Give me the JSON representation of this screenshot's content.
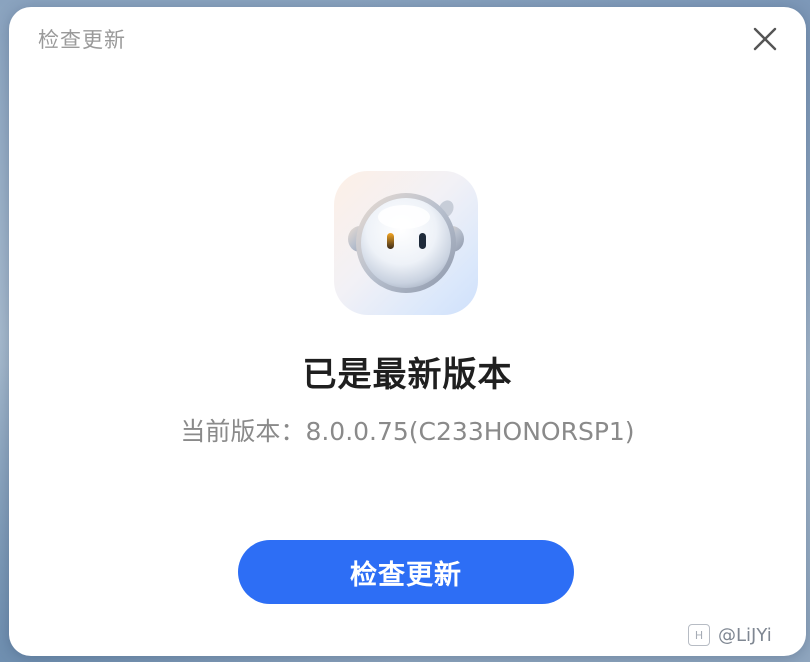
{
  "dialog": {
    "title": "检查更新",
    "close_icon": "close-icon"
  },
  "app": {
    "icon": "assistant-mascot-icon"
  },
  "status": {
    "title": "已是最新版本",
    "version_label": "当前版本：",
    "version_value": "8.0.0.75(C233HONORSP1)"
  },
  "actions": {
    "check_update_label": "检查更新"
  },
  "watermark": {
    "logo_text": "H",
    "text": "@LiJYi"
  },
  "colors": {
    "accent": "#2d6ef5",
    "title_text": "#1f1f1f",
    "secondary_text": "#8a8a8a"
  }
}
